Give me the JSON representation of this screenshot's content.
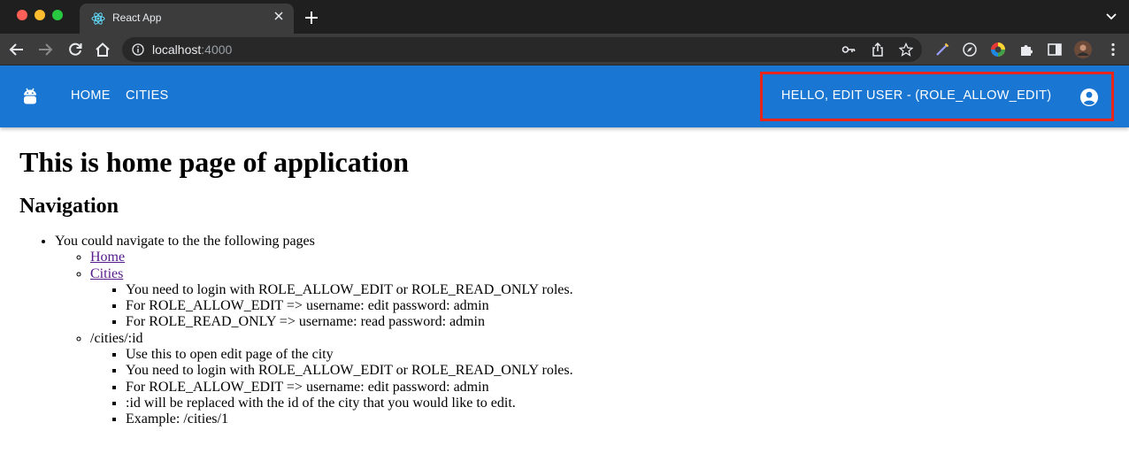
{
  "browser": {
    "tab_title": "React App",
    "url_host": "localhost",
    "url_port": ":4000"
  },
  "colors": {
    "appbar": "#1976d2",
    "highlight_border": "#e8251b",
    "visited_link": "#551a8b"
  },
  "icons": {
    "app_logo": "android-icon",
    "account": "account-circle-icon"
  },
  "appbar": {
    "nav": [
      {
        "label": "HOME"
      },
      {
        "label": "CITIES"
      }
    ],
    "user_greeting": "HELLO, EDIT USER - (ROLE_ALLOW_EDIT)"
  },
  "page": {
    "title": "This is home page of application",
    "nav_heading": "Navigation",
    "intro": "You could navigate to the the following pages",
    "links": {
      "home": "Home",
      "cities": "Cities"
    },
    "cities_notes": [
      "You need to login with ROLE_ALLOW_EDIT or ROLE_READ_ONLY roles.",
      "For ROLE_ALLOW_EDIT => username: edit password: admin",
      "For ROLE_READ_ONLY => username: read password: admin"
    ],
    "city_edit_route": "/cities/:id",
    "city_edit_notes": [
      "Use this to open edit page of the city",
      "You need to login with ROLE_ALLOW_EDIT or ROLE_READ_ONLY roles.",
      "For ROLE_ALLOW_EDIT => username: edit password: admin",
      ":id will be replaced with the id of the city that you would like to edit.",
      "Example: /cities/1"
    ]
  }
}
